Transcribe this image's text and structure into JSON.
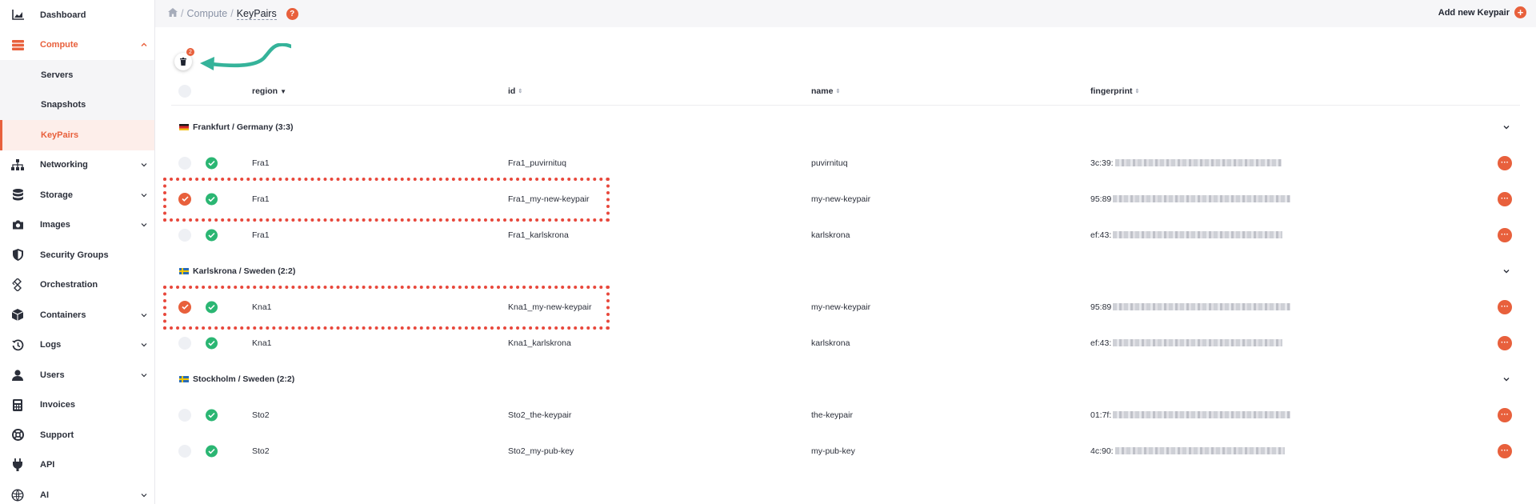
{
  "colors": {
    "accent": "#e8603c",
    "success": "#2bb673",
    "highlight": "#e8483c"
  },
  "sidebar": {
    "items": [
      {
        "label": "Dashboard",
        "icon": "chart-icon"
      },
      {
        "label": "Compute",
        "icon": "server-icon",
        "expanded": true,
        "children": [
          {
            "label": "Servers"
          },
          {
            "label": "Snapshots"
          },
          {
            "label": "KeyPairs",
            "active": true
          }
        ]
      },
      {
        "label": "Networking",
        "icon": "network-icon"
      },
      {
        "label": "Storage",
        "icon": "database-icon"
      },
      {
        "label": "Images",
        "icon": "camera-icon"
      },
      {
        "label": "Security Groups",
        "icon": "shield-icon"
      },
      {
        "label": "Orchestration",
        "icon": "orchestration-icon"
      },
      {
        "label": "Containers",
        "icon": "box-icon"
      },
      {
        "label": "Logs",
        "icon": "history-icon"
      },
      {
        "label": "Users",
        "icon": "user-icon"
      },
      {
        "label": "Invoices",
        "icon": "calculator-icon"
      },
      {
        "label": "Support",
        "icon": "lifebuoy-icon"
      },
      {
        "label": "API",
        "icon": "plug-icon"
      },
      {
        "label": "AI",
        "icon": "ai-icon"
      }
    ]
  },
  "topbar": {
    "crumbs": [
      "Compute",
      "KeyPairs"
    ],
    "separator": "/",
    "help": "?",
    "add_label": "Add new Keypair",
    "add_symbol": "+"
  },
  "toolbar": {
    "selected_count": "2"
  },
  "table": {
    "columns": [
      "region",
      "id",
      "name",
      "fingerprint"
    ],
    "groups": [
      {
        "label": "Frankfurt / Germany (3:3)",
        "flag": "de"
      },
      {
        "label": "Karlskrona / Sweden (2:2)",
        "flag": "se"
      },
      {
        "label": "Stockholm / Sweden (2:2)",
        "flag": "se"
      }
    ],
    "rows": [
      {
        "region": "Fra1",
        "id": "Fra1_puvirnituq",
        "name": "puvirnituq",
        "fp": "3c:39:",
        "selected": false
      },
      {
        "region": "Fra1",
        "id": "Fra1_my-new-keypair",
        "name": "my-new-keypair",
        "fp": "95:89",
        "selected": true
      },
      {
        "region": "Fra1",
        "id": "Fra1_karlskrona",
        "name": "karlskrona",
        "fp": "ef:43:",
        "selected": false
      },
      {
        "region": "Kna1",
        "id": "Kna1_my-new-keypair",
        "name": "my-new-keypair",
        "fp": "95:89",
        "selected": true
      },
      {
        "region": "Kna1",
        "id": "Kna1_karlskrona",
        "name": "karlskrona",
        "fp": "ef:43:",
        "selected": false
      },
      {
        "region": "Sto2",
        "id": "Sto2_the-keypair",
        "name": "the-keypair",
        "fp": "01:7f:",
        "selected": false
      },
      {
        "region": "Sto2",
        "id": "Sto2_my-pub-key",
        "name": "my-pub-key",
        "fp": "4c:90:",
        "selected": false
      }
    ]
  }
}
